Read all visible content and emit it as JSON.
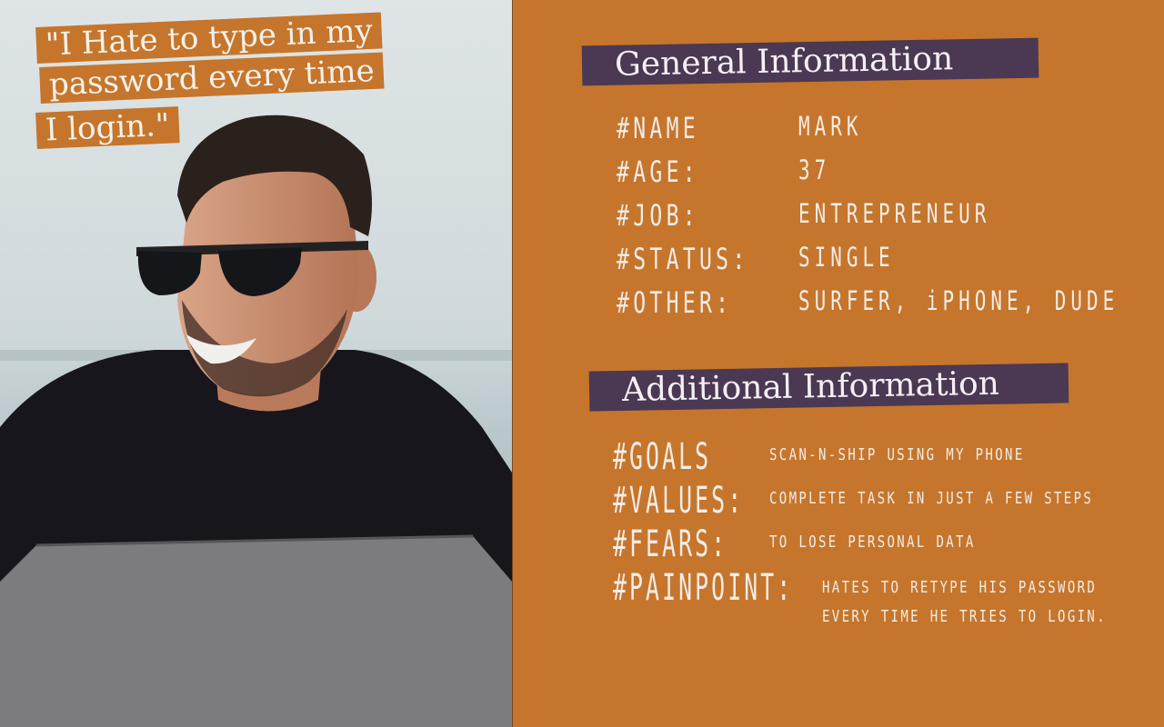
{
  "quote": {
    "line1": "\"I Hate to type in my",
    "line2": "password every time",
    "line3": "I login.\""
  },
  "general": {
    "title": "General Information",
    "rows": [
      {
        "label": "#NAME",
        "value": "MARK"
      },
      {
        "label": "#AGE:",
        "value": "37"
      },
      {
        "label": "#JOB:",
        "value": "ENTREPRENEUR"
      },
      {
        "label": "#STATUS:",
        "value": "SINGLE"
      },
      {
        "label": "#OTHER:",
        "value": "SURFER, iPHONE, DUDE"
      }
    ]
  },
  "additional": {
    "title": "Additional Information",
    "rows": [
      {
        "label": "#GOALS",
        "value": "scan-n-ship using my phone"
      },
      {
        "label": "#VALUES:",
        "value": "complete task in just a few steps"
      },
      {
        "label": "#FEARS:",
        "value": "To lose personal data"
      },
      {
        "label": "#PAINPOINT:",
        "value": "hates to retype his password",
        "value2": "every time he tries to login."
      }
    ]
  },
  "colors": {
    "background": "#c5762c",
    "banner": "#4b3852",
    "text": "#f4ece6"
  }
}
